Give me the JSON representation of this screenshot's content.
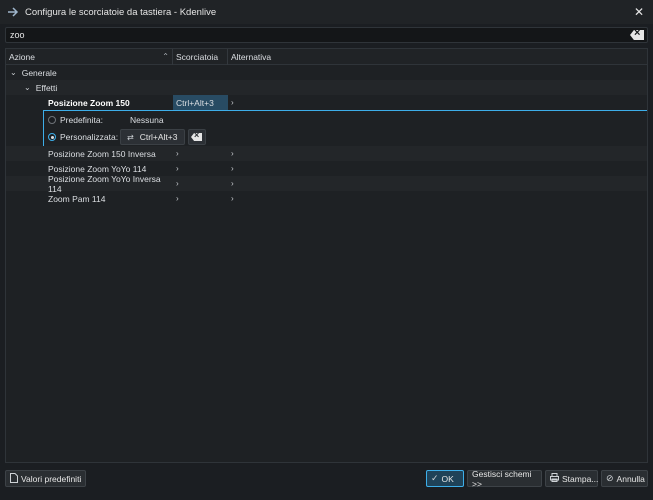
{
  "window": {
    "title": "Configura le scorciatoie da tastiera - Kdenlive",
    "app_icon": "arrow-icon",
    "close_icon": "close-icon"
  },
  "search": {
    "value": "zoo",
    "placeholder": ""
  },
  "columns": {
    "azione": "Azione",
    "scorciatoia": "Scorciatoia",
    "alternativa": "Alternativa"
  },
  "tree": {
    "group": "Generale",
    "subgroup": "Effetti",
    "selected": {
      "label": "Posizione Zoom 150",
      "shortcut": "Ctrl+Alt+3",
      "default_label": "Predefinita:",
      "default_value": "Nessuna",
      "custom_label": "Personalizzata:",
      "custom_value": "Ctrl+Alt+3"
    },
    "items": [
      {
        "label": "Posizione Zoom 150 Inversa"
      },
      {
        "label": "Posizione Zoom YoYo 114"
      },
      {
        "label": "Posizione Zoom YoYo Inversa 114"
      },
      {
        "label": "Zoom Pam 114"
      }
    ]
  },
  "footer": {
    "defaults": "Valori predefiniti",
    "ok": "OK",
    "schemes": "Gestisci schemi >>",
    "print": "Stampa...",
    "cancel": "Annulla"
  },
  "colors": {
    "accent": "#3daee9",
    "background": "#1b1e22",
    "selection": "#284b63"
  }
}
